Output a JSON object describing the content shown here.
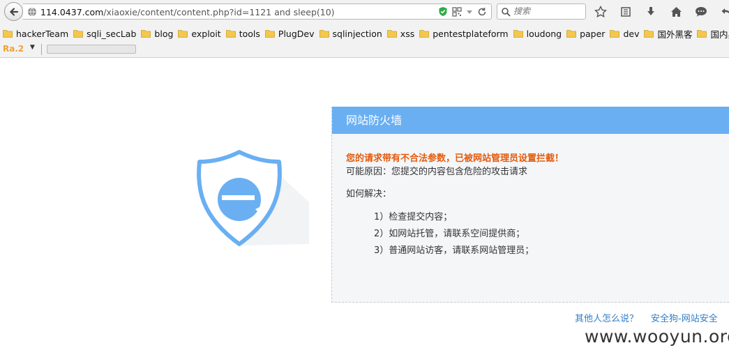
{
  "browser": {
    "url_host": "114.0437.com",
    "url_path": "/xiaoxie/content/content.php?id=1121 and sleep(10)",
    "search_placeholder": "搜索",
    "bookmarks": [
      "hackerTeam",
      "sqli_secLab",
      "blog",
      "exploit",
      "tools",
      "PlugDev",
      "sqlinjection",
      "xss",
      "pentestplateform",
      "loudong",
      "paper",
      "dev",
      "国外黑客",
      "国内黑客"
    ],
    "addon_label": "Ra.2"
  },
  "waf": {
    "title": "网站防火墙",
    "warning": "您的请求带有不合法参数，已被网站管理员设置拦截！",
    "reason": "可能原因：您提交的内容包含危险的攻击请求",
    "howto": "如何解决：",
    "steps": [
      "1）检查提交内容；",
      "2）如网站托管，请联系空间提供商；",
      "3）普通网站访客，请联系网站管理员；"
    ]
  },
  "footer": {
    "link_others": "其他人怎么说？",
    "link_safedog": "安全狗-网站安全"
  },
  "watermark": "www.wooyun.org",
  "colors": {
    "accent": "#6aaff2",
    "warning": "#e45a0c",
    "link": "#2f7ec8",
    "folder": "#f5c84c"
  }
}
